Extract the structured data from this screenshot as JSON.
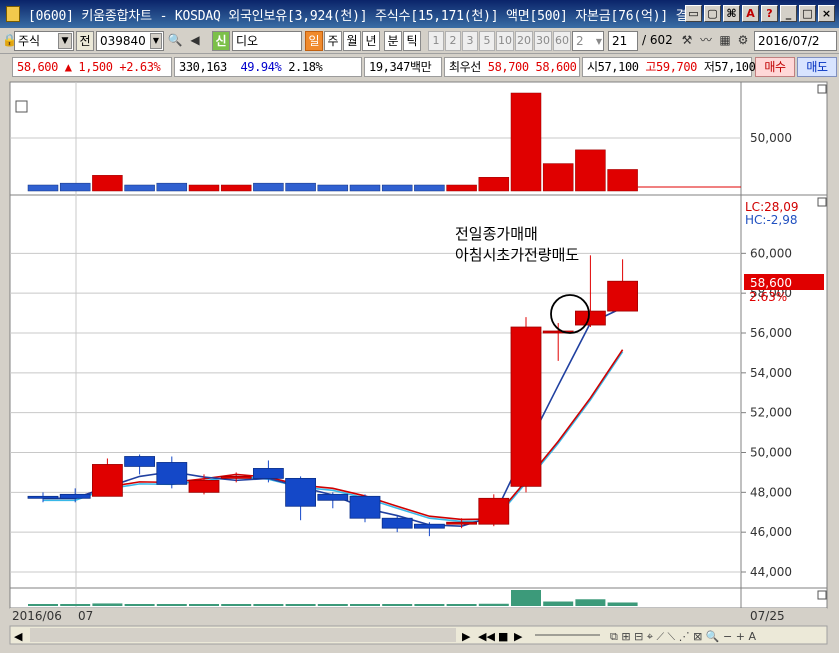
{
  "window": {
    "title": "[0600] 키움종합차트 - KOSDAQ 외국인보유[3,924(천)] 주식수[15,171(천)] 액면[500] 자본금[76(억)] 결"
  },
  "toolbar": {
    "market": "주식",
    "code_label": "전",
    "stock_code": "039840",
    "stock_tag": "신",
    "stock_name": "디오",
    "periods": [
      "일",
      "주",
      "월",
      "년",
      "분",
      "틱"
    ],
    "active_period": "일",
    "intervals": [
      "1",
      "2",
      "3",
      "5",
      "10",
      "20",
      "30",
      "60"
    ],
    "interval_value": "2",
    "count_value": "21",
    "count_total": "/ 602",
    "date": "2016/07/2"
  },
  "infobar": {
    "price": "58,600",
    "change": "▲ 1,500",
    "change_rate": "+2.63%",
    "volume": "330,163",
    "ratio1": "49.94%",
    "ratio2": "2.18%",
    "amount": "19,347백만",
    "best_label": "최우선",
    "best_ask": "58,700",
    "best_bid": "58,600",
    "open": "시57,100",
    "high": "고59,700",
    "low": "저57,100",
    "buy": "매수",
    "sell": "매도"
  },
  "chart": {
    "top_axis_label": "50,000",
    "price_axis": [
      "60,000",
      "58,000",
      "56,000",
      "54,000",
      "52,000",
      "50,000",
      "48,000",
      "46,000",
      "44,000"
    ],
    "lc_label": "LC:28,09",
    "hc_label": "HC:-2,98",
    "current_price": "58,600",
    "current_pct": "2.63%",
    "annotation_line1": "전일종가매매",
    "annotation_line2": "아침시초가전량매도",
    "date_left": "2016/06",
    "date_tick": "07",
    "date_right": "07/25",
    "colors": {
      "up": "#e00000",
      "down": "#1448c8",
      "ma_blue": "#2040a0",
      "ma_red": "#d00000",
      "ma_cyan": "#38b8e8",
      "vol_green": "#3c9a7a"
    }
  },
  "candles": [
    {
      "o": 47800,
      "c": 47700,
      "h": 48000,
      "l": 47500
    },
    {
      "o": 47900,
      "c": 47700,
      "h": 48200,
      "l": 47500
    },
    {
      "o": 47800,
      "c": 49400,
      "h": 49700,
      "l": 47800
    },
    {
      "o": 49800,
      "c": 49300,
      "h": 49900,
      "l": 48900
    },
    {
      "o": 49500,
      "c": 48400,
      "h": 49800,
      "l": 48200
    },
    {
      "o": 48000,
      "c": 48600,
      "h": 48900,
      "l": 47900
    },
    {
      "o": 48700,
      "c": 48800,
      "h": 49000,
      "l": 48500
    },
    {
      "o": 49200,
      "c": 48700,
      "h": 49600,
      "l": 48500
    },
    {
      "o": 48700,
      "c": 47300,
      "h": 48800,
      "l": 46600
    },
    {
      "o": 47900,
      "c": 47600,
      "h": 48000,
      "l": 47200
    },
    {
      "o": 47800,
      "c": 46700,
      "h": 47900,
      "l": 46500
    },
    {
      "o": 46700,
      "c": 46200,
      "h": 46800,
      "l": 46000
    },
    {
      "o": 46400,
      "c": 46200,
      "h": 46500,
      "l": 45800
    },
    {
      "o": 46500,
      "c": 46500,
      "h": 46700,
      "l": 46200
    },
    {
      "o": 46400,
      "c": 47700,
      "h": 47900,
      "l": 46300
    },
    {
      "o": 48300,
      "c": 56300,
      "h": 56800,
      "l": 48000
    },
    {
      "o": 56000,
      "c": 56100,
      "h": 56500,
      "l": 54600
    },
    {
      "o": 56400,
      "c": 57100,
      "h": 59900,
      "l": 56300
    },
    {
      "o": 57100,
      "c": 58600,
      "h": 59700,
      "l": 57100
    }
  ],
  "volumes": [
    3,
    4,
    8,
    3,
    4,
    3,
    3,
    4,
    4,
    3,
    3,
    3,
    3,
    3,
    7,
    50,
    14,
    21,
    11
  ]
}
